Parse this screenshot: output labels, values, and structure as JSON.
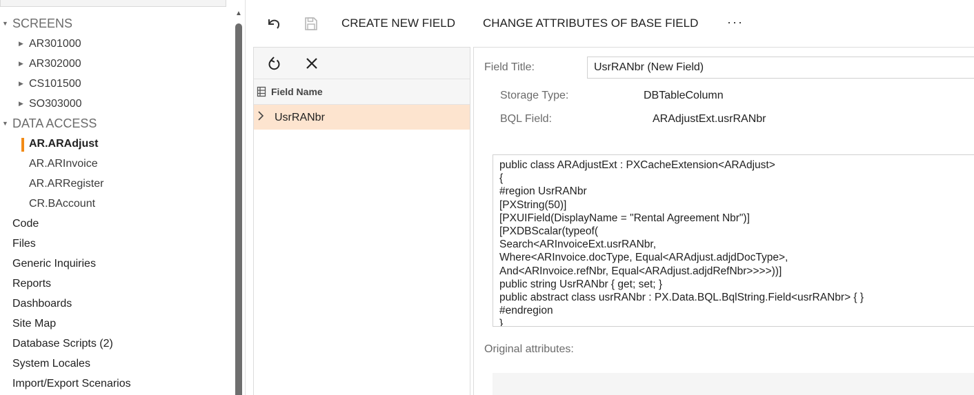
{
  "tree": {
    "items": [
      {
        "label": "SCREENS",
        "level": 0,
        "caps": true,
        "toggle": "expanded"
      },
      {
        "label": "AR301000",
        "level": 1,
        "toggle": "collapsed"
      },
      {
        "label": "AR302000",
        "level": 1,
        "toggle": "collapsed"
      },
      {
        "label": "CS101500",
        "level": 1,
        "toggle": "collapsed"
      },
      {
        "label": "SO303000",
        "level": 1,
        "toggle": "collapsed"
      },
      {
        "label": "DATA ACCESS",
        "level": 0,
        "caps": true,
        "toggle": "expanded"
      },
      {
        "label": "AR.ARAdjust",
        "level": 1,
        "selected": true
      },
      {
        "label": "AR.ARInvoice",
        "level": 1
      },
      {
        "label": "AR.ARRegister",
        "level": 1
      },
      {
        "label": "CR.BAccount",
        "level": 1
      },
      {
        "label": "Code",
        "level": 0
      },
      {
        "label": "Files",
        "level": 0
      },
      {
        "label": "Generic Inquiries",
        "level": 0
      },
      {
        "label": "Reports",
        "level": 0
      },
      {
        "label": "Dashboards",
        "level": 0
      },
      {
        "label": "Site Map",
        "level": 0
      },
      {
        "label": "Database Scripts (2)",
        "level": 0
      },
      {
        "label": "System Locales",
        "level": 0
      },
      {
        "label": "Import/Export Scenarios",
        "level": 0
      }
    ],
    "toggle_glyphs": {
      "expanded": "▼",
      "collapsed": "▶"
    },
    "accent_color": "#f28a16"
  },
  "toolbar": {
    "undo_icon": "undo-icon",
    "save_icon": "save-icon",
    "create_new_field_label": "CREATE NEW FIELD",
    "change_attributes_label": "CHANGE ATTRIBUTES OF BASE FIELD",
    "more_label": "···"
  },
  "field_grid": {
    "refresh_icon": "refresh-icon",
    "delete_icon": "close-icon",
    "column_header": "Field Name",
    "rows": [
      {
        "field_name": "UsrRANbr",
        "selected": true
      }
    ],
    "selected_row_color": "#fde4cf"
  },
  "details": {
    "field_title_label": "Field Title:",
    "field_title_value": "UsrRANbr (New Field)",
    "storage_type_label": "Storage Type:",
    "storage_type_value": "DBTableColumn",
    "bql_field_label": "BQL Field:",
    "bql_field_value": "ARAdjustExt.usrRANbr",
    "code_lines": [
      "public class ARAdjustExt : PXCacheExtension<ARAdjust>",
      "{",
      "#region UsrRANbr",
      "[PXString(50)]",
      "[PXUIField(DisplayName = \"Rental Agreement Nbr\")]",
      "[PXDBScalar(typeof(",
      "Search<ARInvoiceExt.usrRANbr,",
      "Where<ARInvoice.docType, Equal<ARAdjust.adjdDocType>,",
      "And<ARInvoice.refNbr, Equal<ARAdjust.adjdRefNbr>>>>))]",
      "public string UsrRANbr { get; set; }",
      "public abstract class usrRANbr : PX.Data.BQL.BqlString.Field<usrRANbr> { }",
      "#endregion",
      "}"
    ],
    "original_attributes_label": "Original attributes:"
  }
}
